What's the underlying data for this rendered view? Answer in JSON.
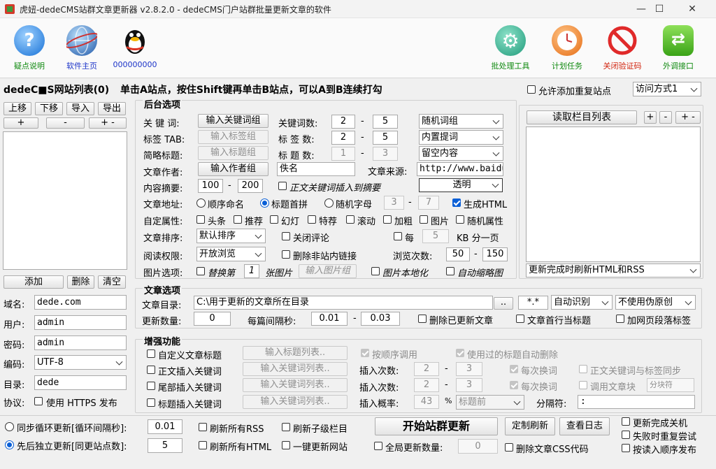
{
  "window": {
    "title": "虎妞-dedeCMS站群文章更新器 v2.8.2.0 - dedeCMS门户站群批量更新文章的软件",
    "min": "—",
    "max": "☐",
    "close": "✕"
  },
  "toolbar": {
    "help": "疑点说明",
    "home": "软件主页",
    "qq": "000000000",
    "batch": "批处理工具",
    "plan": "计划任务",
    "captcha": "关闭验证码",
    "api": "外调接口"
  },
  "sitelist": {
    "title": "dedeC■S网站列表(0)",
    "hint": "单击A站点，按住Shift键再单击B站点，可以A到B连续打勾",
    "allow_dup": "允许添加重复站点",
    "access": "访问方式1",
    "btn_up": "上移",
    "btn_down": "下移",
    "btn_import": "导入",
    "btn_export": "导出",
    "btn_plus": "+",
    "btn_minus": "-",
    "btn_pm": "+ -",
    "btn_add": "添加",
    "btn_del": "删除",
    "btn_clear": "清空",
    "domain_label": "域名:",
    "domain": "dede.com",
    "user_label": "用户:",
    "user": "admin",
    "pass_label": "密码:",
    "pass": "admin",
    "enc_label": "编码:",
    "enc": "UTF-8",
    "dir_label": "目录:",
    "dir": "dede",
    "proto_label": "协议:",
    "https": "使用 HTTPS 发布"
  },
  "backend": {
    "title": "后台选项",
    "kw_label": "关 键 词:",
    "kw_btn": "输入关键词组",
    "kwcount_label": "关键词数:",
    "kw_min": "2",
    "kw_max": "5",
    "kw_mode": "随机词组",
    "tag_label": "标签 TAB:",
    "tag_btn": "输入标签组",
    "tagcount_label": "标 签 数:",
    "tag_min": "2",
    "tag_max": "5",
    "tag_mode": "内置提词",
    "brief_label": "简略标题:",
    "brief_btn": "输入标题组",
    "titlecount_label": "标 题 数:",
    "title_min": "1",
    "title_max": "3",
    "title_mode": "留空内容",
    "author_label": "文章作者:",
    "author_btn": "输入作者组",
    "author": "佚名",
    "source_label": "文章来源:",
    "source": "http://www.baidu",
    "summary_label": "内容摘要:",
    "sum_min": "100",
    "sum_max": "200",
    "sum_insert": "正文关键词插入到摘要",
    "color": "透明",
    "url_label": "文章地址:",
    "url_seq": "顺序命名",
    "url_pinyin": "标题首拼",
    "url_rand": "随机字母",
    "url_min": "3",
    "url_max": "7",
    "gen_html": "生成HTML",
    "attr_label": "自定属性:",
    "attrs": [
      "头条",
      "推荐",
      "幻灯",
      "特荐",
      "滚动",
      "加粗",
      "图片",
      "随机属性"
    ],
    "sort_label": "文章排序:",
    "sort": "默认排序",
    "close_comment": "关闭评论",
    "per_page_pre": "每",
    "per_page": "5",
    "per_page_post": "KB 分一页",
    "perm_label": "阅读权限:",
    "perm": "开放浏览",
    "del_links": "删除非站内链接",
    "views_label": "浏览次数:",
    "views_min": "50",
    "views_max": "150",
    "img_label": "图片选项:",
    "img_replace": "替换第",
    "img_n": "1",
    "img_unit": "张图片",
    "img_btn": "输入图片组",
    "img_local": "图片本地化",
    "img_thumb": "自动缩略图"
  },
  "columns": {
    "read_btn": "读取栏目列表",
    "plus": "+",
    "minus": "-",
    "pm1": "+",
    "pm2": "-",
    "refresh_mode": "更新完成时刷新HTML和RSS"
  },
  "article": {
    "title": "文章选项",
    "dir_label": "文章目录:",
    "dir": "C:\\用于更新的文章所在目录",
    "dots": "..",
    "ext": "*.*",
    "detect": "自动识别",
    "pseudo": "不使用伪原创",
    "count_label": "更新数量:",
    "count": "0",
    "interval_label": "每篇间隔秒:",
    "iv_min": "0.01",
    "iv_max": "0.03",
    "del_updated": "删除已更新文章",
    "first_line": "文章首行当标题",
    "page_break": "加网页段落标签"
  },
  "enhance": {
    "title": "增强功能",
    "custom_title": "自定义文章标题",
    "custom_btn": "输入标题列表..",
    "seq_use": "按顺序调用",
    "auto_del": "使用过的标题自动删除",
    "body_kw": "正文插入关键词",
    "body_btn": "输入关键词列表..",
    "ins_label1": "插入次数:",
    "ins1_min": "2",
    "ins1_max": "3",
    "each1": "每次换词",
    "sync": "正文关键词与标签同步",
    "tail_kw": "尾部插入关键词",
    "tail_btn": "输入关键词列表..",
    "ins_label2": "插入次数:",
    "ins2_min": "2",
    "ins2_max": "3",
    "each2": "每次换词",
    "block": "调用文章块",
    "block_ph": "分块符",
    "title_kw": "标题插入关键词",
    "title_btn": "输入关键词列表..",
    "prob_label": "插入概率:",
    "prob": "43",
    "pct": "%",
    "pos": "标题前",
    "sep_label": "分隔符:",
    "sep": ":"
  },
  "bottom": {
    "sync_loop": "同步循环更新[循环间隔秒]:",
    "loop_iv": "0.01",
    "seq_update": "先后独立更新[同更站点数]:",
    "seq_n": "5",
    "rss": "刷新所有RSS",
    "html": "刷新所有HTML",
    "sub": "刷新子级栏目",
    "one_key": "一键更新网站",
    "start": "开始站群更新",
    "custom_refresh": "定制刷新",
    "view_log": "查看日志",
    "global_label": "全局更新数量:",
    "global_count": "0",
    "del_css": "删除文章CSS代码",
    "shutdown": "更新完成关机",
    "retry": "失败时重复尝试",
    "read_order": "按读入顺序发布"
  }
}
